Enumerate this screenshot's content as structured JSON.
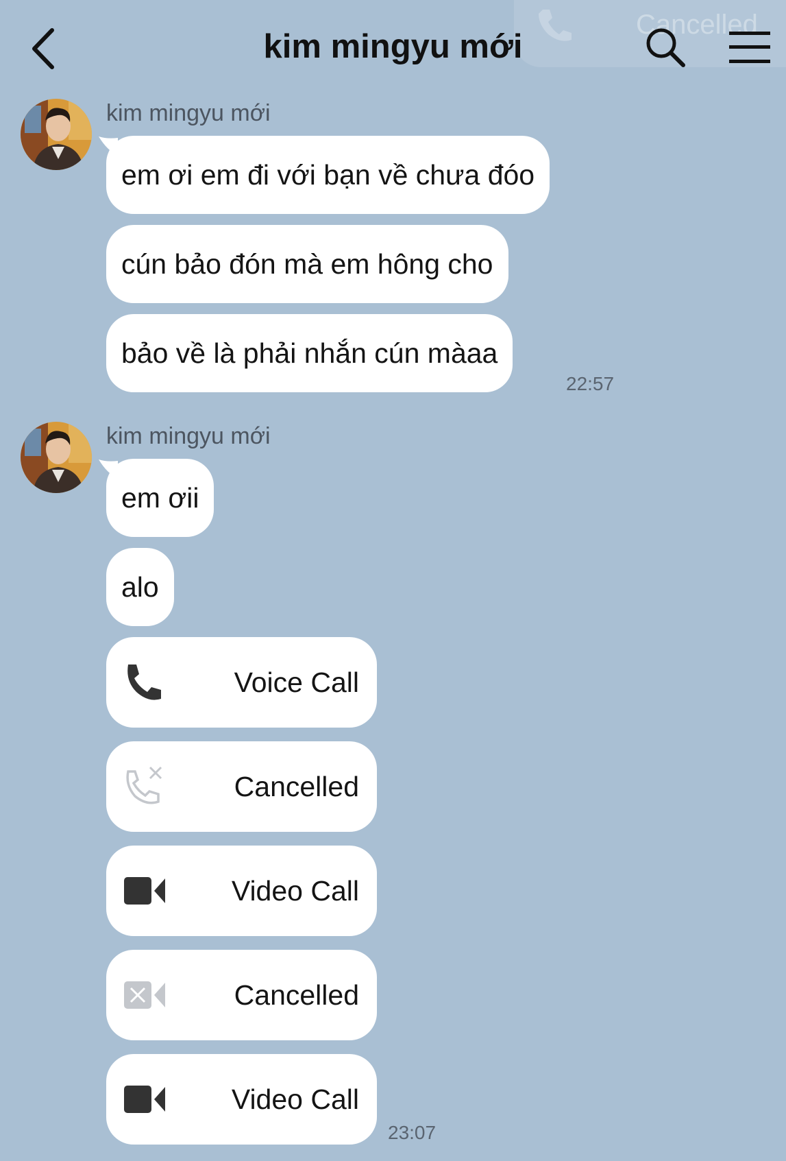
{
  "header": {
    "title": "kim mingyu mới",
    "back_icon": "chevron-left-icon",
    "search_icon": "search-icon",
    "menu_icon": "hamburger-menu-icon"
  },
  "ghost_overlay": {
    "label": "Cancelled"
  },
  "groups": [
    {
      "sender": "kim mingyu mới",
      "messages": [
        "em ơi em đi với bạn về chưa đóo",
        "cún bảo đón mà em hông cho",
        "bảo về là phải nhắn cún màaa"
      ],
      "time": "22:57"
    },
    {
      "sender": "kim mingyu mới",
      "messages": [
        "em ơii",
        "alo"
      ],
      "calls": [
        {
          "type": "voice",
          "label": "Voice Call",
          "icon": "phone-icon"
        },
        {
          "type": "voice-cancelled",
          "label": "Cancelled",
          "icon": "phone-cancelled-icon"
        },
        {
          "type": "video",
          "label": "Video Call",
          "icon": "video-camera-icon"
        },
        {
          "type": "video-cancelled",
          "label": "Cancelled",
          "icon": "video-cancelled-icon"
        },
        {
          "type": "video",
          "label": "Video Call",
          "icon": "video-camera-icon"
        }
      ],
      "time": "23:07"
    }
  ],
  "colors": {
    "background": "#a9bfd3",
    "bubble": "#ffffff",
    "text": "#141414",
    "muted_icon": "#c4c7cc"
  }
}
